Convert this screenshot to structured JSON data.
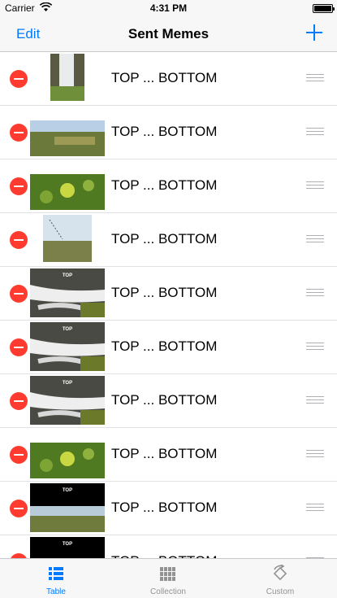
{
  "status_bar": {
    "carrier": "Carrier",
    "time": "4:31 PM"
  },
  "nav": {
    "edit_label": "Edit",
    "title": "Sent Memes",
    "add_icon": "plus-icon"
  },
  "colors": {
    "accent": "#007aff",
    "delete": "#ff3b30",
    "tab_inactive": "#929292"
  },
  "rows": [
    {
      "label": "TOP ... BOTTOM",
      "thumb": "waterfall",
      "thumb_text": ""
    },
    {
      "label": "TOP ... BOTTOM",
      "thumb": "meadow",
      "thumb_text": ""
    },
    {
      "label": "TOP ... BOTTOM",
      "thumb": "flower",
      "thumb_text": ""
    },
    {
      "label": "TOP ... BOTTOM",
      "thumb": "field",
      "thumb_text": ""
    },
    {
      "label": "TOP ... BOTTOM",
      "thumb": "stream",
      "thumb_text": "TOP"
    },
    {
      "label": "TOP ... BOTTOM",
      "thumb": "stream",
      "thumb_text": "TOP"
    },
    {
      "label": "TOP ... BOTTOM",
      "thumb": "stream",
      "thumb_text": "TOP"
    },
    {
      "label": "TOP ... BOTTOM",
      "thumb": "flower",
      "thumb_text": ""
    },
    {
      "label": "TOP ... BOTTOM",
      "thumb": "black-meadow",
      "thumb_text": "TOP"
    },
    {
      "label": "TOP ... BOTTOM",
      "thumb": "black-flower",
      "thumb_text": "TOP"
    }
  ],
  "tabs": [
    {
      "label": "Table",
      "icon": "list-icon",
      "selected": true
    },
    {
      "label": "Collection",
      "icon": "grid-icon",
      "selected": false
    },
    {
      "label": "Custom",
      "icon": "rotate-icon",
      "selected": false
    }
  ]
}
